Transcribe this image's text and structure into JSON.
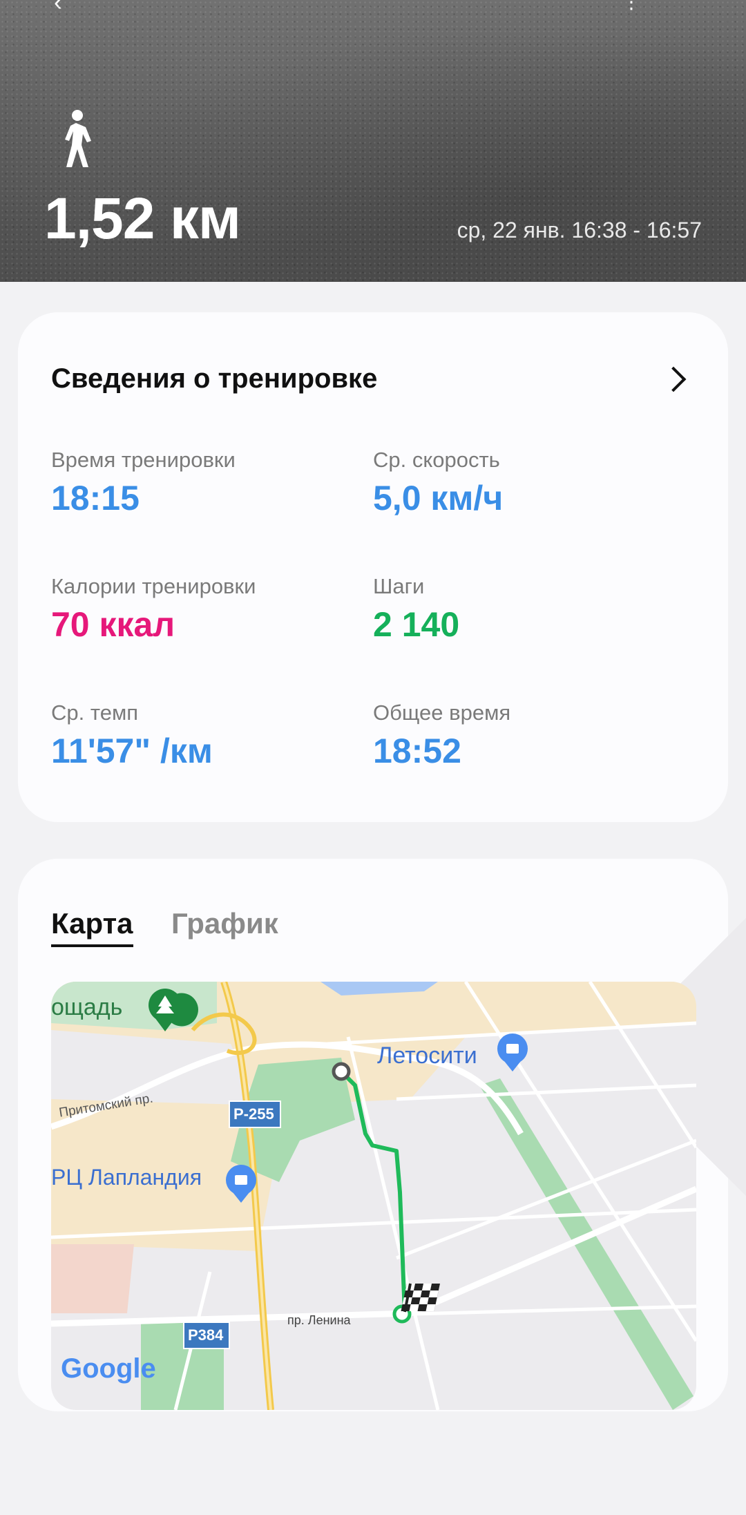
{
  "hero": {
    "distance": "1,52 км",
    "date_range": "ср, 22 янв. 16:38 - 16:57",
    "activity_icon": "walking-person-icon"
  },
  "details": {
    "title": "Сведения о тренировке",
    "stats": [
      {
        "label": "Время тренировки",
        "value": "18:15",
        "color": "#3a8ee6"
      },
      {
        "label": "Ср. скорость",
        "value": "5,0 км/ч",
        "color": "#3a8ee6"
      },
      {
        "label": "Калории тренировки",
        "value": "70 ккал",
        "color": "#e6187a"
      },
      {
        "label": "Шаги",
        "value": "2 140",
        "color": "#15b05a"
      },
      {
        "label": "Ср. темп",
        "value": "11'57\" /км",
        "color": "#3a8ee6"
      },
      {
        "label": "Общее время",
        "value": "18:52",
        "color": "#3a8ee6"
      }
    ]
  },
  "map_card": {
    "tabs": [
      "Карта",
      "График"
    ],
    "active_tab": "Карта",
    "map": {
      "labels": {
        "square": "ощадь",
        "letocity": "Летосити",
        "pritomsky": "Притомский пр.",
        "r255": "Р-255",
        "laplandia": "РЦ Лапландия",
        "r384": "Р384",
        "lenina": "пр. Ленина",
        "google": "Google"
      },
      "route_color": "#1fba5a"
    }
  }
}
